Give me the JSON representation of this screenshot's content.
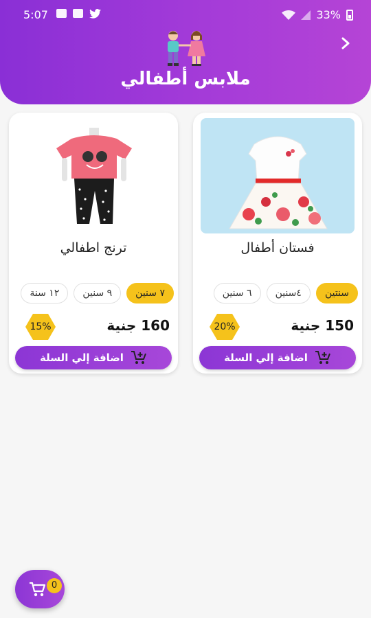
{
  "status": {
    "time": "5:07",
    "battery": "33%"
  },
  "header": {
    "title": "ملابس أطفالي"
  },
  "products": [
    {
      "name": "فستان أطفال",
      "sizes": [
        "سنتين",
        "٤سنين",
        "٦ سنين"
      ],
      "selected_size": "سنتين",
      "price": "150 جنية",
      "discount": "20%",
      "cart_label": "اضافة إلي السلة"
    },
    {
      "name": "ترنج اطفالي",
      "sizes": [
        "٧ سنين",
        "٩ سنين",
        "١٢ سنة"
      ],
      "selected_size": "٧ سنين",
      "price": "160 جنية",
      "discount": "15%",
      "cart_label": "اضافة إلي السلة"
    }
  ],
  "cart": {
    "count": "0"
  },
  "colors": {
    "primary": "#9b3fd8",
    "accent": "#f5c21b"
  },
  "icons": [
    "kids-logo-icon",
    "back-arrow-icon",
    "add-to-cart-icon",
    "cart-icon",
    "wifi-icon",
    "signal-icon",
    "battery-icon",
    "twitter-icon"
  ]
}
